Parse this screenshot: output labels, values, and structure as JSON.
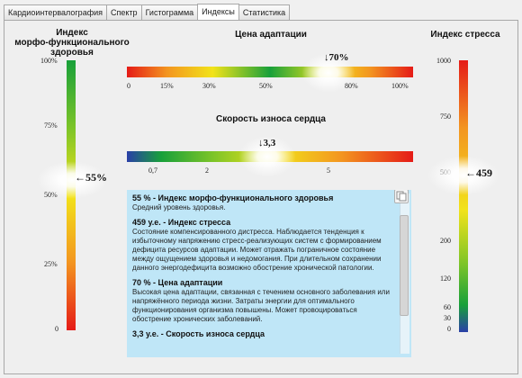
{
  "tabs": [
    "Кардиоинтервалография",
    "Спектр",
    "Гистограмма",
    "Индексы",
    "Статистика"
  ],
  "active_tab": "Индексы",
  "mfz": {
    "title_line1": "Индекс",
    "title_line2": "морфо-функционального",
    "title_line3": "здоровья",
    "ticks": [
      "100%",
      "75%",
      "50%",
      "25%",
      "0"
    ],
    "value": "55%"
  },
  "adapt": {
    "title": "Цена адаптации",
    "ticks": [
      "0",
      "15%",
      "30%",
      "50%",
      "80%",
      "100%"
    ],
    "value": "70%"
  },
  "wear": {
    "title": "Скорость износа сердца",
    "ticks": [
      "0,7",
      "2",
      "5"
    ],
    "value": "3,3"
  },
  "stress": {
    "title": "Индекс стресса",
    "ticks": [
      "1000",
      "750",
      "500",
      "200",
      "120",
      "60",
      "30",
      "0"
    ],
    "value": "459"
  },
  "info": [
    {
      "heading": "55 % - Индекс морфо-функционального здоровья",
      "text": "Средний уровень здоровья."
    },
    {
      "heading": "459 у.е. - Индекс стресса",
      "text": "Состояние компенсированного дистресса. Наблюдается тенденция к избыточному напряжению стресс-реализующих систем с формированием дефицита ресурсов адаптации. Может отражать пограничное состояние между ощущением здоровья и недомогания. При длительном сохранении данного энергодефицита возможно обострение хронической патологии."
    },
    {
      "heading": "70 %  - Цена адаптации",
      "text": "Высокая цена адаптации, связанная с течением основного заболевания или напряжённого периода жизни. Затраты энергии для оптимального функционирования организма повышены. Может провоцироваться обострение хронических заболеваний."
    },
    {
      "heading": "3,3 у.е. - Скорость износа сердца",
      "text": ""
    }
  ]
}
